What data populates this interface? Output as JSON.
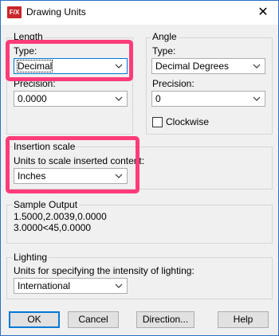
{
  "window": {
    "title": "Drawing Units",
    "app_icon": "F/X",
    "close_glyph": "✕"
  },
  "length": {
    "group_label": "Length",
    "type_label": "Type:",
    "type_value": "Decimal",
    "precision_label": "Precision:",
    "precision_value": "0.0000"
  },
  "angle": {
    "group_label": "Angle",
    "type_label": "Type:",
    "type_value": "Decimal Degrees",
    "precision_label": "Precision:",
    "precision_value": "0",
    "clockwise_label": "Clockwise",
    "clockwise_checked": false
  },
  "insertion_scale": {
    "group_label": "Insertion scale",
    "units_label": "Units to scale inserted content:",
    "units_value": "Inches"
  },
  "sample_output": {
    "group_label": "Sample Output",
    "line1": "1.5000,2.0039,0.0000",
    "line2": "3.0000<45,0.0000"
  },
  "lighting": {
    "group_label": "Lighting",
    "units_label": "Units for specifying the intensity of lighting:",
    "units_value": "International"
  },
  "buttons": {
    "ok": "OK",
    "cancel": "Cancel",
    "direction": "Direction...",
    "help": "Help"
  },
  "colors": {
    "highlight": "#ff3b7a",
    "accent": "#0078d7"
  }
}
